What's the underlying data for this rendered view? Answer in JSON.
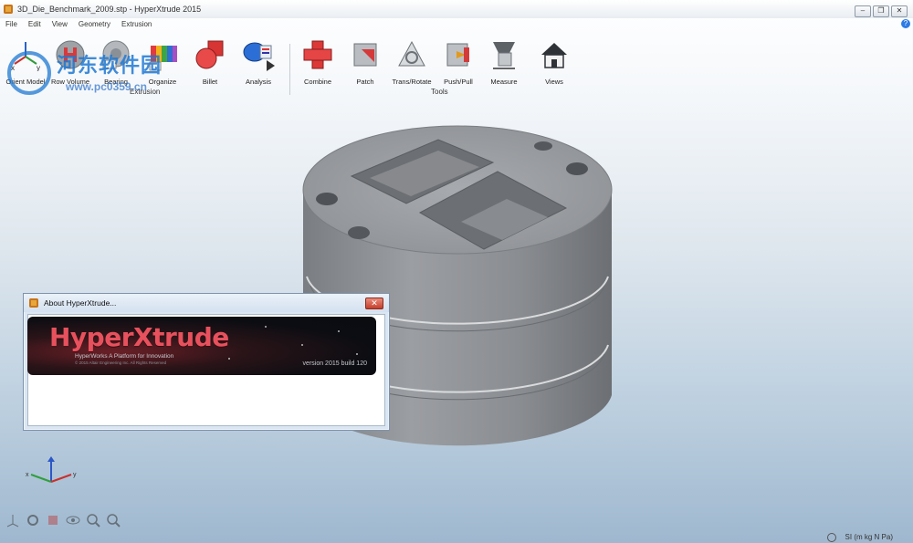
{
  "window": {
    "title": "3D_Die_Benchmark_2009.stp - HyperXtrude 2015",
    "controls": {
      "minimize": "–",
      "restore": "❐",
      "close": "✕"
    }
  },
  "menubar": {
    "items": [
      "File",
      "Edit",
      "View",
      "Geometry",
      "Extrusion"
    ],
    "help": "?"
  },
  "watermark": {
    "text": "河东软件园",
    "url": "www.pc0359.cn"
  },
  "toolbar": {
    "extrusion_group_label": "Extrusion",
    "tools_group_label": "Tools",
    "extrusion_tools": [
      {
        "label": "Orient Model",
        "icon": "orient-model-icon"
      },
      {
        "label": "Row Volume",
        "icon": "row-volume-icon"
      },
      {
        "label": "Bearing",
        "icon": "bearing-icon"
      },
      {
        "label": "Organize",
        "icon": "organize-icon"
      },
      {
        "label": "Billet",
        "icon": "billet-icon"
      },
      {
        "label": "Analysis",
        "icon": "analysis-icon"
      }
    ],
    "tools": [
      {
        "label": "Combine",
        "icon": "combine-icon"
      },
      {
        "label": "Patch",
        "icon": "patch-icon"
      },
      {
        "label": "Trans/Rotate",
        "icon": "trans-rotate-icon"
      },
      {
        "label": "Push/Pull",
        "icon": "push-pull-icon"
      },
      {
        "label": "Measure",
        "icon": "measure-icon"
      },
      {
        "label": "Views",
        "icon": "views-icon"
      }
    ]
  },
  "about_dialog": {
    "title": "About HyperXtrude...",
    "close": "✕",
    "product_name": "HyperXtrude",
    "tagline": "HyperWorks A Platform for Innovation",
    "copyright": "© 2015 Altair Engineering Inc. All Rights Reserved",
    "version": "version 2015 build 120"
  },
  "statusbar": {
    "units": "SI (m kg N Pa)"
  },
  "colors": {
    "accent": "#2c7be5",
    "brand_red": "#e7515d",
    "model_gray": "#8c8f93"
  }
}
